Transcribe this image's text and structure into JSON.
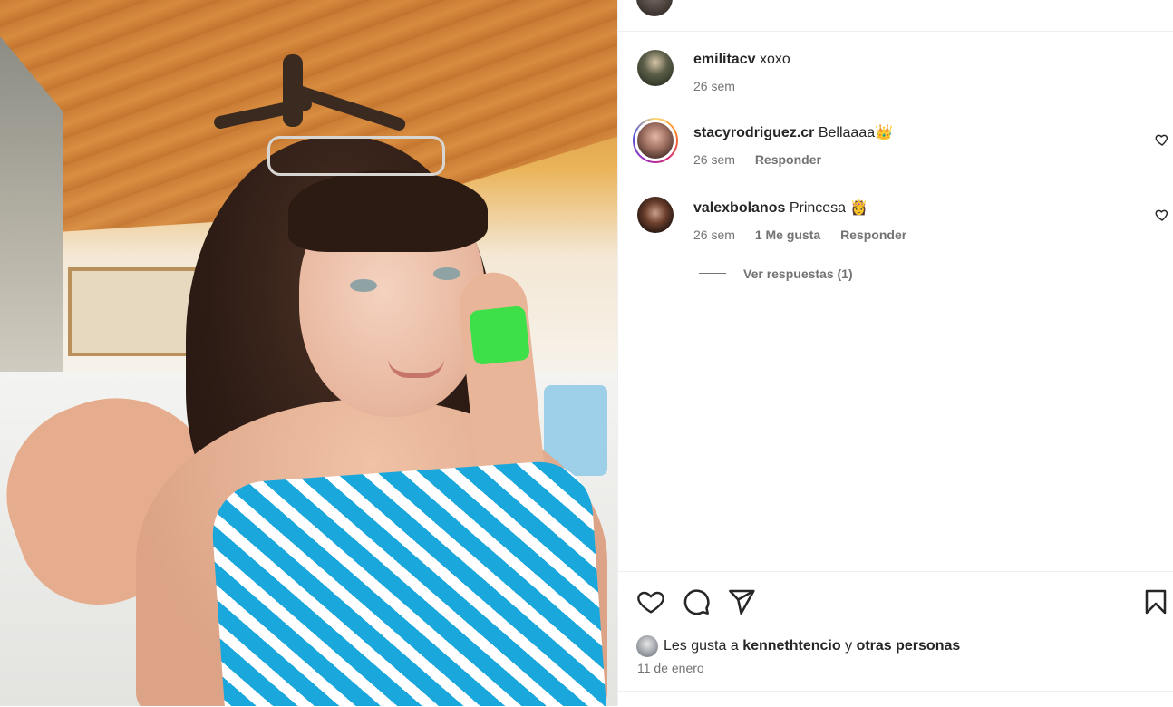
{
  "post_image": {
    "icon": "photo"
  },
  "comments": [
    {
      "username": "emilitacv",
      "text": "xoxo",
      "time": "26 sem"
    },
    {
      "username": "stacyrodriguez.cr",
      "text": "Bellaaaa👑",
      "time": "26 sem",
      "reply_label": "Responder"
    },
    {
      "username": "valexbolanos",
      "text": "Princesa 👸",
      "time": "26 sem",
      "likes_label": "1 Me gusta",
      "reply_label": "Responder",
      "view_replies_label": "Ver respuestas (1)"
    }
  ],
  "actions": {
    "like_icon": "heart-icon",
    "comment_icon": "comment-icon",
    "share_icon": "share-icon",
    "save_icon": "bookmark-icon"
  },
  "likes": {
    "prefix": "Les gusta a",
    "liker": "kennethtencio",
    "connector": "y",
    "others": "otras personas"
  },
  "date": "11 de enero"
}
